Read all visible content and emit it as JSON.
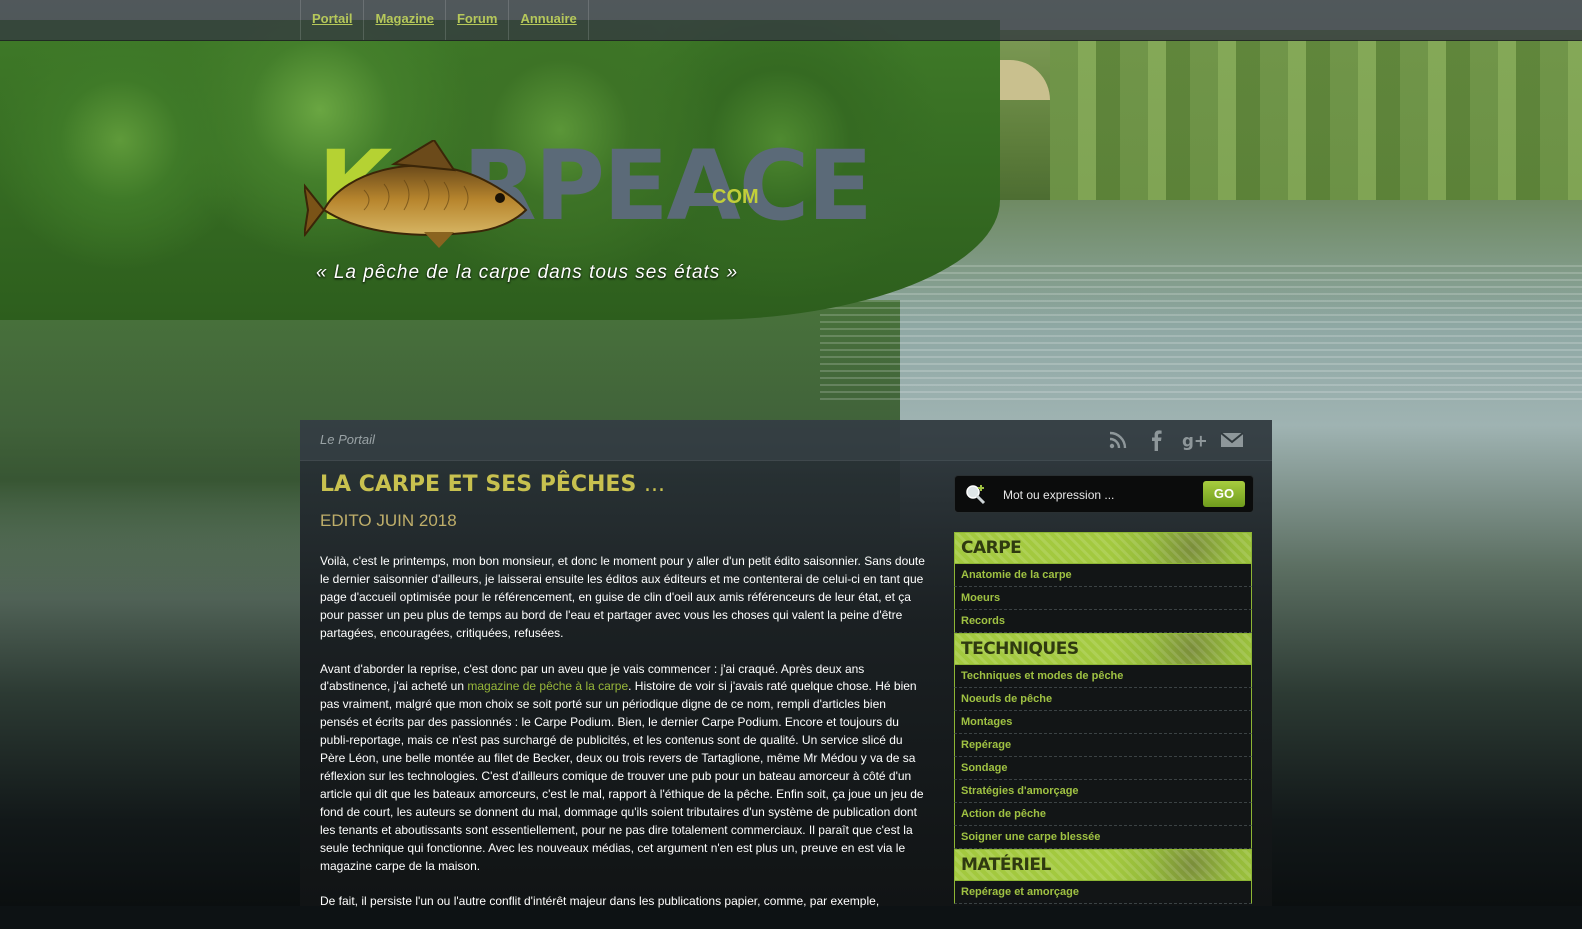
{
  "nav": {
    "items": [
      {
        "label": "Portail"
      },
      {
        "label": "Magazine"
      },
      {
        "label": "Forum"
      },
      {
        "label": "Annuaire"
      }
    ]
  },
  "logo": {
    "k_letter": "K",
    "word_rest": "ARPEACE",
    "suffix": "COM",
    "tagline": "« La pêche de la carpe dans tous ses états »"
  },
  "breadcrumb": "Le Portail",
  "social": {
    "icons": [
      "rss-icon",
      "facebook-icon",
      "google-plus-icon",
      "mail-icon"
    ]
  },
  "article": {
    "title": "La carpe et ses pêches",
    "title_suffix": "...",
    "subtitle": "EDITO JUIN 2018",
    "p1": "Voilà, c'est le printemps, mon bon monsieur, et donc le moment pour y aller d'un petit édito saisonnier. Sans doute le dernier saisonnier d'ailleurs, je laisserai ensuite les éditos aux éditeurs et me contenterai de celui-ci en tant que page d'accueil optimisée pour le référencement, en guise de clin d'oeil aux amis référenceurs de leur état, et ça pour passer un peu plus de temps au bord de l'eau et partager avec vous les choses qui valent la peine d'être partagées, encouragées, critiquées, refusées.",
    "p2_before": "Avant d'aborder la reprise, c'est donc par un aveu que je vais commencer : j'ai craqué. Après deux ans d'abstinence, j'ai acheté un ",
    "p2_link": "magazine de pêche à la carpe",
    "p2_after": ". Histoire de voir si j'avais raté quelque chose. Hé bien pas vraiment, malgré que mon choix se soit porté sur un périodique digne de ce nom, rempli d'articles bien pensés et écrits par des passionnés : le Carpe Podium. Bien, le dernier Carpe Podium. Encore et toujours du publi-reportage, mais ce n'est pas surchargé de publicités, et les contenus sont de qualité. Un service slicé du Père Léon, une belle montée au filet de Becker, deux ou trois revers de Tartaglione, même Mr Médou y va de sa réflexion sur les technologies. C'est d'ailleurs comique de trouver une pub pour un bateau amorceur à côté d'un article qui dit que les bateaux amorceurs, c'est le mal, rapport à l'éthique de la pêche. Enfin soit, ça joue un jeu de fond de court, les auteurs se donnent du mal, dommage qu'ils soient tributaires d'un système de publication dont les tenants et aboutissants sont essentiellement, pour ne pas dire totalement commerciaux. Il paraît que c'est la seule technique qui fonctionne. Avec les nouveaux médias, cet argument n'en est plus un, preuve en est via le magazine carpe de la maison.",
    "p3": "De fait, il persiste l'un ou l'autre conflit d'intérêt majeur dans les publications papier, comme, par exemple,"
  },
  "search": {
    "placeholder": "Mot ou expression ...",
    "button_label": "GO"
  },
  "sidebar": {
    "sections": [
      {
        "title": "CARPE",
        "items": [
          "Anatomie de la carpe",
          "Moeurs",
          "Records"
        ]
      },
      {
        "title": "TECHNIQUES",
        "items": [
          "Techniques et modes de pêche",
          "Noeuds de pêche",
          "Montages",
          "Repérage",
          "Sondage",
          "Stratégies d'amorçage",
          "Action de pêche",
          "Soigner une carpe blessée"
        ]
      },
      {
        "title": "MATÉRIEL",
        "items": [
          "Repérage et amorçage"
        ]
      }
    ]
  },
  "colors": {
    "accent_green": "#b6c85a",
    "link_green": "#98b83a",
    "title_gold": "#c8c14f",
    "category_band": "#a3c93f"
  }
}
